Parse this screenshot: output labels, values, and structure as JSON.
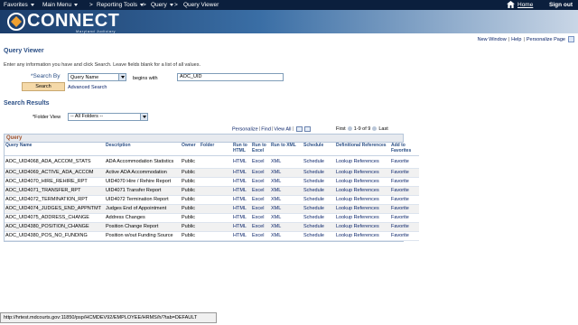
{
  "topnav": {
    "favorites": "Favorites",
    "main_menu": "Main Menu",
    "breadcrumb": [
      "Reporting Tools",
      "Query",
      "Query Viewer"
    ],
    "home": "Home",
    "sign_out": "Sign out"
  },
  "banner": {
    "logo": "CONNECT",
    "subtitle": "Maryland Judiciary"
  },
  "utility": {
    "new_window": "New Window",
    "help": "Help",
    "personalize": "Personalize Page"
  },
  "page": {
    "title": "Query Viewer",
    "instructions": "Enter any information you have and click Search. Leave fields blank for a list of all values."
  },
  "search": {
    "label": "*Search By",
    "search_by_value": "Query Name",
    "operator": "begins with",
    "input_value": "AOC_UID",
    "button": "Search",
    "advanced": "Advanced Search"
  },
  "results": {
    "title": "Search Results",
    "folder_label": "*Folder View",
    "folder_value": "-- All Folders --"
  },
  "grid_toolbar": {
    "personalize": "Personalize",
    "find": "Find",
    "view_all": "View All",
    "first": "First",
    "count": "1-9 of 9",
    "last": "Last"
  },
  "grid": {
    "title": "Query",
    "headers": [
      "Query Name",
      "Description",
      "Owner",
      "Folder",
      "Run to HTML",
      "Run to Excel",
      "Run to XML",
      "Schedule",
      "Definitional References",
      "Add to Favorites"
    ],
    "rows": [
      [
        "AOC_UID4068_ADA_ACCOM_STATS",
        "ADA Accommodation Statistics",
        "Public",
        "",
        "HTML",
        "Excel",
        "XML",
        "Schedule",
        "Lookup References",
        "Favorite"
      ],
      [
        "AOC_UID4069_ACTIVE_ADA_ACCOM",
        "Active ADA Accommodation",
        "Public",
        "",
        "HTML",
        "Excel",
        "XML",
        "Schedule",
        "Lookup References",
        "Favorite"
      ],
      [
        "AOC_UID4070_HIRE_REHIRE_RPT",
        "UID4070 Hire / Rehire Report",
        "Public",
        "",
        "HTML",
        "Excel",
        "XML",
        "Schedule",
        "Lookup References",
        "Favorite"
      ],
      [
        "AOC_UID4071_TRANSFER_RPT",
        "UID4071 Transfer Report",
        "Public",
        "",
        "HTML",
        "Excel",
        "XML",
        "Schedule",
        "Lookup References",
        "Favorite"
      ],
      [
        "AOC_UID4072_TERMINATION_RPT",
        "UID4072 Termination Report",
        "Public",
        "",
        "HTML",
        "Excel",
        "XML",
        "Schedule",
        "Lookup References",
        "Favorite"
      ],
      [
        "AOC_UID4074_JUDGES_END_APPNTMT",
        "Judges End of Appointment",
        "Public",
        "",
        "HTML",
        "Excel",
        "XML",
        "Schedule",
        "Lookup References",
        "Favorite"
      ],
      [
        "AOC_UID4075_ADDRESS_CHANGE",
        "Address Changes",
        "Public",
        "",
        "HTML",
        "Excel",
        "XML",
        "Schedule",
        "Lookup References",
        "Favorite"
      ],
      [
        "AOC_UID4380_POSITION_CHANGE",
        "Position Change Report",
        "Public",
        "",
        "HTML",
        "Excel",
        "XML",
        "Schedule",
        "Lookup References",
        "Favorite"
      ],
      [
        "AOC_UID4380_POS_NO_FUNDING",
        "Position w/out Funding Source",
        "Public",
        "",
        "HTML",
        "Excel",
        "XML",
        "Schedule",
        "Lookup References",
        "Favorite"
      ]
    ]
  },
  "statusbar": {
    "url": "http://hrtest.mdcourts.gov:11850/psp/HCMDEV92/EMPLOYEE/HRMS/h/?tab=DEFAULT"
  },
  "colors": {
    "nav_bg": "#0b1f3d",
    "heading": "#2b4f86",
    "link": "#0a246a",
    "grid_title": "#a0522d",
    "search_button": "#f5d9a8"
  }
}
